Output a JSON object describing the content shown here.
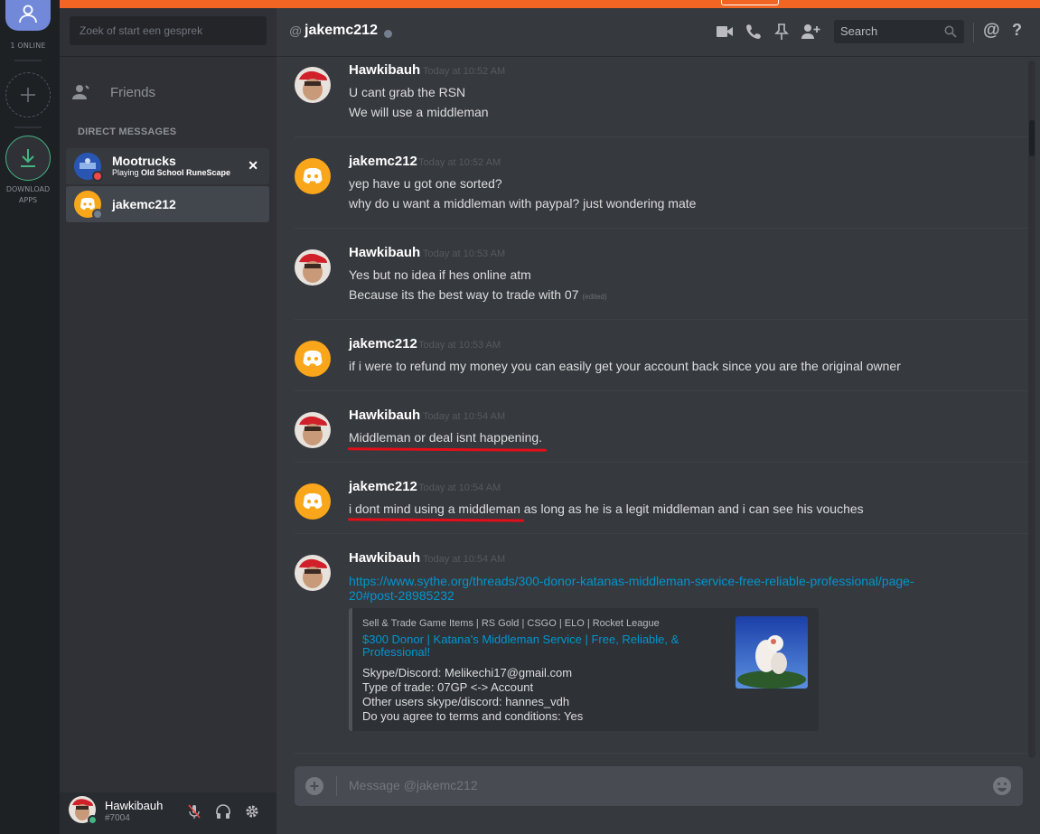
{
  "guilds": {
    "online_count": "1 ONLINE",
    "download_label_1": "DOWNLOAD",
    "download_label_2": "APPS"
  },
  "sidebar": {
    "search_placeholder": "Zoek of start een gesprek",
    "friends_label": "Friends",
    "dm_header": "DIRECT MESSAGES",
    "dms": [
      {
        "name": "Mootrucks",
        "activity_prefix": "Playing ",
        "activity_game": "Old School RuneScape",
        "status_color": "#f04747",
        "close": "✕"
      },
      {
        "name": "jakemc212",
        "status_color": "#747f8d"
      }
    ]
  },
  "user": {
    "name": "Hawkibauh",
    "tag": "#7004"
  },
  "header": {
    "at": "@",
    "channel": "jakemc212",
    "search_placeholder": "Search",
    "mention": "@",
    "help": "?"
  },
  "messages": [
    {
      "author": "Hawkibauh",
      "time": "Today at 10:52 AM",
      "avatar": "hawk",
      "lines": [
        "U cant grab the RSN",
        "We will use a middleman"
      ]
    },
    {
      "author": "jakemc212",
      "time": "Today at 10:52 AM",
      "avatar": "discord",
      "lines": [
        "yep have u got one sorted?",
        "why do u want a middleman with paypal? just wondering mate"
      ]
    },
    {
      "author": "Hawkibauh",
      "time": "Today at 10:53 AM",
      "avatar": "hawk",
      "lines": [
        "Yes but no idea if hes online atm",
        "Because its the best way to trade with 07"
      ],
      "edited": "(edited)"
    },
    {
      "author": "jakemc212",
      "time": "Today at 10:53 AM",
      "avatar": "discord",
      "lines": [
        "if i were to refund my money you can easily get your account back since you are the original owner"
      ]
    },
    {
      "author": "Hawkibauh",
      "time": "Today at 10:54 AM",
      "avatar": "hawk",
      "lines": [
        "Middleman or deal isnt happening."
      ]
    },
    {
      "author": "jakemc212",
      "time": "Today at 10:54 AM",
      "avatar": "discord",
      "lines": [
        "i dont mind using a middleman as long as he is a legit middleman and i can see his vouches"
      ]
    },
    {
      "author": "Hawkibauh",
      "time": "Today at 10:54 AM",
      "avatar": "hawk",
      "link_1": "https://www.sythe.org/threads/300-donor-katanas-middleman-service-free-reliable-professional/page-",
      "link_2": "20#post-28985232",
      "embed": {
        "provider": "Sell & Trade Game Items | RS Gold | CSGO | ELO | Rocket League",
        "title": "$300 Donor | Katana's Middleman Service | Free, Reliable, & Professional!",
        "lines": [
          "Skype/Discord: Melikechi17@gmail.com",
          "Type of trade: 07GP <-> Account",
          "Other users skype/discord: hannes_vdh",
          "Do you agree to terms and conditions: Yes"
        ]
      }
    }
  ],
  "composer": {
    "placeholder": "Message @jakemc212"
  },
  "colors": {
    "topbar": "#f26522",
    "blurple": "#7289da",
    "discord_avatar": "#faa61a",
    "link": "#0096cf",
    "underline": "#e20f1a"
  }
}
